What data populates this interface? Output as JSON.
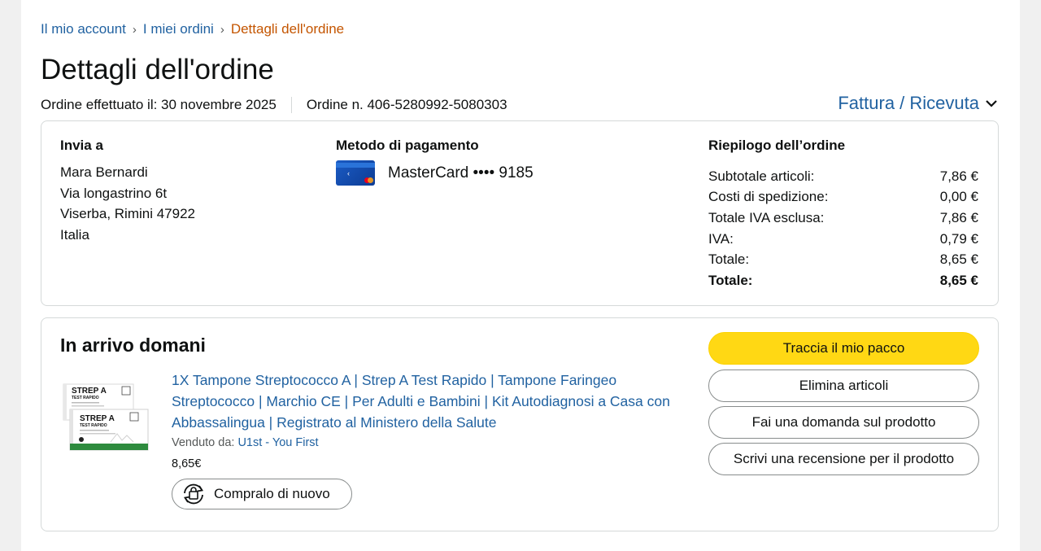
{
  "breadcrumb": {
    "items": [
      "Il mio account",
      "I miei ordini"
    ],
    "separator": "›",
    "current": "Dettagli dell'ordine"
  },
  "page_title": "Dettagli dell'ordine",
  "order_meta": {
    "placed": "Ordine effettuato il: 30 novembre 2025",
    "number": "Ordine n. 406-5280992-5080303"
  },
  "invoice_link": {
    "label": "Fattura / Ricevuta",
    "icon": "chevron-down-icon"
  },
  "ship_to": {
    "heading": "Invia a",
    "lines": [
      "Mara Bernardi",
      "Via longastrino 6t",
      "Viserba, Rimini 47922",
      "Italia"
    ]
  },
  "payment": {
    "heading": "Metodo di pagamento",
    "text": "MasterCard •••• 9185",
    "icon": "credit-card-icon"
  },
  "summary": {
    "heading": "Riepilogo dell’ordine",
    "rows": [
      {
        "label": "Subtotale articoli:",
        "value": "7,86 €"
      },
      {
        "label": "Costi di spedizione:",
        "value": "0,00 €"
      },
      {
        "label": "Totale IVA esclusa:",
        "value": "7,86 €"
      },
      {
        "label": "IVA:",
        "value": "0,79 €"
      },
      {
        "label": "Totale:",
        "value": "8,65 €"
      },
      {
        "label": "Totale:",
        "value": "8,65 €"
      }
    ]
  },
  "shipment": {
    "status": "In arrivo domani",
    "product": {
      "title": "1X Tampone Streptococco A | Strep A Test Rapido | Tampone Faringeo Streptococco | Marchio CE | Per Adulti e Bambini | Kit Autodiagnosi a Casa con Abbassalingua | Registrato al Ministero della Salute",
      "sold_by_label": "Venduto da:",
      "seller": "U1st - You First",
      "price": "8,65€",
      "image_text": {
        "brand": "STREP A",
        "sub": "TEST RAPIDO"
      }
    },
    "buy_again": {
      "label": "Compralo di nuovo",
      "icon": "buy-again-icon"
    },
    "buttons": {
      "track": "Traccia il mio pacco",
      "remove": "Elimina articoli",
      "question": "Fai una domanda sul prodotto",
      "review": "Scrivi una recensione per il prodotto"
    }
  },
  "colors": {
    "link": "#2162a1",
    "breadcrumb_current": "#c45500",
    "primary_button": "#ffd814",
    "border": "#d5d9d9"
  }
}
